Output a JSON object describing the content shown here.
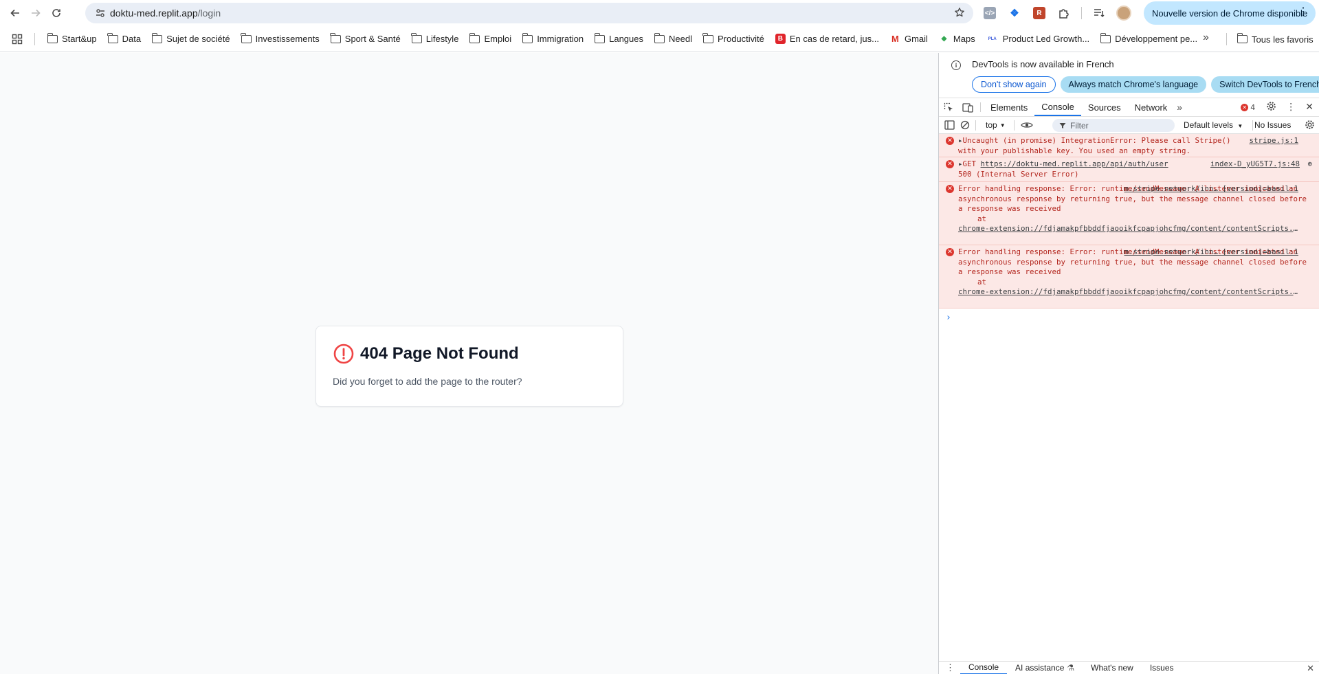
{
  "browser": {
    "url_host": "doktu-med.replit.app",
    "url_path": "/login",
    "update_label": "Nouvelle version de Chrome disponible"
  },
  "bookmarks": {
    "items": [
      {
        "label": "Start&up",
        "icon": "folder-icon"
      },
      {
        "label": "Data",
        "icon": "folder-icon"
      },
      {
        "label": "Sujet de société",
        "icon": "folder-icon"
      },
      {
        "label": "Investissements",
        "icon": "folder-icon"
      },
      {
        "label": "Sport & Santé",
        "icon": "folder-icon"
      },
      {
        "label": "Lifestyle",
        "icon": "folder-icon"
      },
      {
        "label": "Emploi",
        "icon": "folder-icon"
      },
      {
        "label": "Immigration",
        "icon": "folder-icon"
      },
      {
        "label": "Langues",
        "icon": "folder-icon"
      },
      {
        "label": "Needl",
        "icon": "folder-icon"
      },
      {
        "label": "Productivité",
        "icon": "folder-icon"
      },
      {
        "label": "En cas de retard, jus...",
        "icon": "b-favicon"
      },
      {
        "label": "Gmail",
        "icon": "gmail-icon"
      },
      {
        "label": "Maps",
        "icon": "maps-icon"
      },
      {
        "label": "Product Led Growth...",
        "icon": "pla-favicon"
      },
      {
        "label": "Développement pe...",
        "icon": "folder-icon"
      }
    ],
    "all_label": "Tous les favoris"
  },
  "page": {
    "title": "404 Page Not Found",
    "message": "Did you forget to add the page to the router?"
  },
  "devtools": {
    "infobar": {
      "text": "DevTools is now available in French",
      "btn_dont_show": "Don't show again",
      "btn_match": "Always match Chrome's language",
      "btn_switch": "Switch DevTools to French"
    },
    "tabs": [
      "Elements",
      "Console",
      "Sources",
      "Network"
    ],
    "active_tab": "Console",
    "error_count": "4",
    "context": "top",
    "filter_placeholder": "Filter",
    "levels": "Default levels",
    "issues": "No Issues",
    "messages": [
      {
        "text": "Uncaught (in promise) IntegrationError: Please call Stripe() with your publishable key. You used an empty string.",
        "source": "stripe.js:1"
      },
      {
        "text_prefix": "GET ",
        "url": "https://doktu-med.replit.app/api/auth/user",
        "text_suffix": "500 (Internal Server Error)",
        "source": "index-D_yUG5T7.js:48"
      },
      {
        "text": "Error handling response: Error: runtime/sendMessage: A listener indicated an asynchronous response by returning true, but the message channel closed before a response was received",
        "at": "at",
        "link": "chrome-extension://fdjamakpfbbddfjaooikfcpapjohcfmg/content/contentScripts.js",
        "source": "m.stripe.network/inn… [version]=basil:1"
      },
      {
        "text": "Error handling response: Error: runtime/sendMessage: A listener indicated an asynchronous response by returning true, but the message channel closed before a response was received",
        "at": "at",
        "link": "chrome-extension://fdjamakpfbbddfjaooikfcpapjohcfmg/content/contentScripts.js",
        "source": "m.stripe.network/inn… [version]=basil:1"
      }
    ],
    "drawer_tabs": [
      "Console",
      "AI assistance",
      "What's new",
      "Issues"
    ]
  },
  "colors": {
    "error_red": "#dc362e",
    "error_bg": "#fce8e6",
    "accent_blue": "#1a73e8",
    "update_pill": "#c2e7ff"
  }
}
